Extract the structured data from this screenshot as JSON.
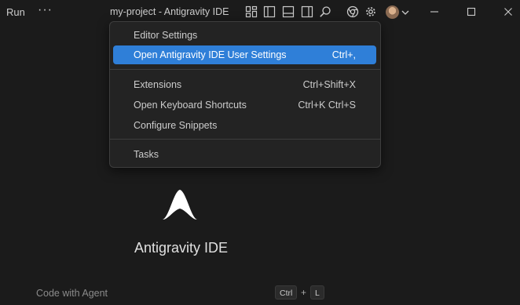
{
  "titlebar": {
    "run_label": "Run",
    "more_label": "···",
    "window_title": "my-project - Antigravity IDE"
  },
  "icons": {
    "layout": "layout-icon",
    "toggle_primary_sidebar": "primary-sidebar-icon",
    "toggle_panel": "panel-icon",
    "toggle_secondary_sidebar": "secondary-sidebar-icon",
    "search": "search-icon",
    "browser": "chrome-icon",
    "settings": "gear-icon",
    "account": "avatar"
  },
  "menu": {
    "items": [
      {
        "label": "Editor Settings",
        "shortcut": ""
      },
      {
        "label": "Open Antigravity IDE User Settings",
        "shortcut": "Ctrl+,"
      },
      {
        "label": "Extensions",
        "shortcut": "Ctrl+Shift+X"
      },
      {
        "label": "Open Keyboard Shortcuts",
        "shortcut": "Ctrl+K Ctrl+S"
      },
      {
        "label": "Configure Snippets",
        "shortcut": ""
      },
      {
        "label": "Tasks",
        "shortcut": ""
      }
    ],
    "highlighted_index": 1
  },
  "center": {
    "product_name": "Antigravity IDE",
    "hint_label": "Code with Agent",
    "hint_keys": [
      "Ctrl",
      "+",
      "L"
    ]
  },
  "colors": {
    "background": "#1b1b1b",
    "menu_background": "#232323",
    "accent": "#2f7fd8"
  }
}
